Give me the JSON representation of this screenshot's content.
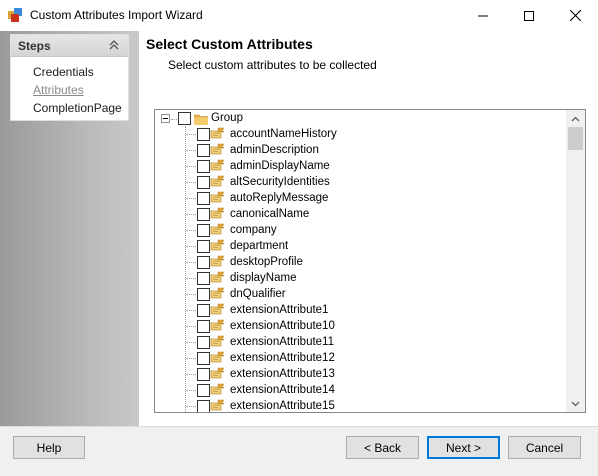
{
  "window": {
    "title": "Custom Attributes Import Wizard"
  },
  "steps": {
    "header": "Steps",
    "items": [
      {
        "label": "Credentials",
        "state": "normal"
      },
      {
        "label": "Attributes",
        "state": "current"
      },
      {
        "label": "CompletionPage",
        "state": "normal"
      }
    ]
  },
  "page": {
    "heading": "Select Custom Attributes",
    "subheading": "Select custom attributes to be collected"
  },
  "tree": {
    "root": {
      "label": "Group",
      "expanded": true,
      "checked": false
    },
    "attributes": [
      "accountNameHistory",
      "adminDescription",
      "adminDisplayName",
      "altSecurityIdentities",
      "autoReplyMessage",
      "canonicalName",
      "company",
      "department",
      "desktopProfile",
      "displayName",
      "dnQualifier",
      "extensionAttribute1",
      "extensionAttribute10",
      "extensionAttribute11",
      "extensionAttribute12",
      "extensionAttribute13",
      "extensionAttribute14",
      "extensionAttribute15"
    ]
  },
  "buttons": {
    "help": "Help",
    "back": "< Back",
    "next": "Next >",
    "cancel": "Cancel"
  },
  "colors": {
    "accent": "#0078d7",
    "folder": "#e8b64c"
  }
}
